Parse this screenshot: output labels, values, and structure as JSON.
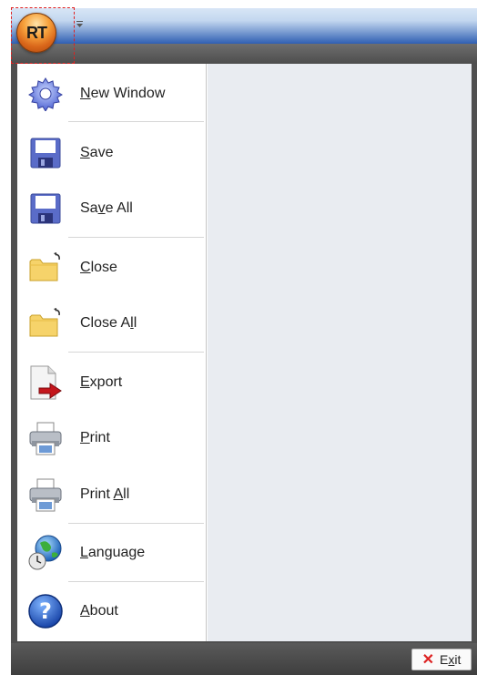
{
  "app_button": {
    "label": "RT"
  },
  "menu": {
    "items": [
      {
        "label_pre": "",
        "mnemonic": "N",
        "label_post": "ew Window",
        "icon": "gear-icon"
      },
      {
        "label_pre": "",
        "mnemonic": "S",
        "label_post": "ave",
        "icon": "floppy-icon"
      },
      {
        "label_pre": "Sa",
        "mnemonic": "v",
        "label_post": "e All",
        "icon": "floppy-icon"
      },
      {
        "label_pre": "",
        "mnemonic": "C",
        "label_post": "lose",
        "icon": "folder-close-icon"
      },
      {
        "label_pre": "Close A",
        "mnemonic": "l",
        "label_post": "l",
        "icon": "folder-close-icon"
      },
      {
        "label_pre": "",
        "mnemonic": "E",
        "label_post": "xport",
        "icon": "export-icon"
      },
      {
        "label_pre": "",
        "mnemonic": "P",
        "label_post": "rint",
        "icon": "printer-icon"
      },
      {
        "label_pre": "Print ",
        "mnemonic": "A",
        "label_post": "ll",
        "icon": "printer-icon"
      },
      {
        "label_pre": "",
        "mnemonic": "L",
        "label_post": "anguage",
        "icon": "globe-clock-icon"
      },
      {
        "label_pre": "",
        "mnemonic": "A",
        "label_post": "bout",
        "icon": "help-icon"
      }
    ]
  },
  "exit": {
    "label_pre": "E",
    "mnemonic": "x",
    "label_post": "it"
  },
  "colors": {
    "accent_orange": "#f7a23c",
    "title_blue": "#2f5fb2",
    "pane_gray": "#e9ecf1",
    "exit_red": "#dd2222"
  }
}
